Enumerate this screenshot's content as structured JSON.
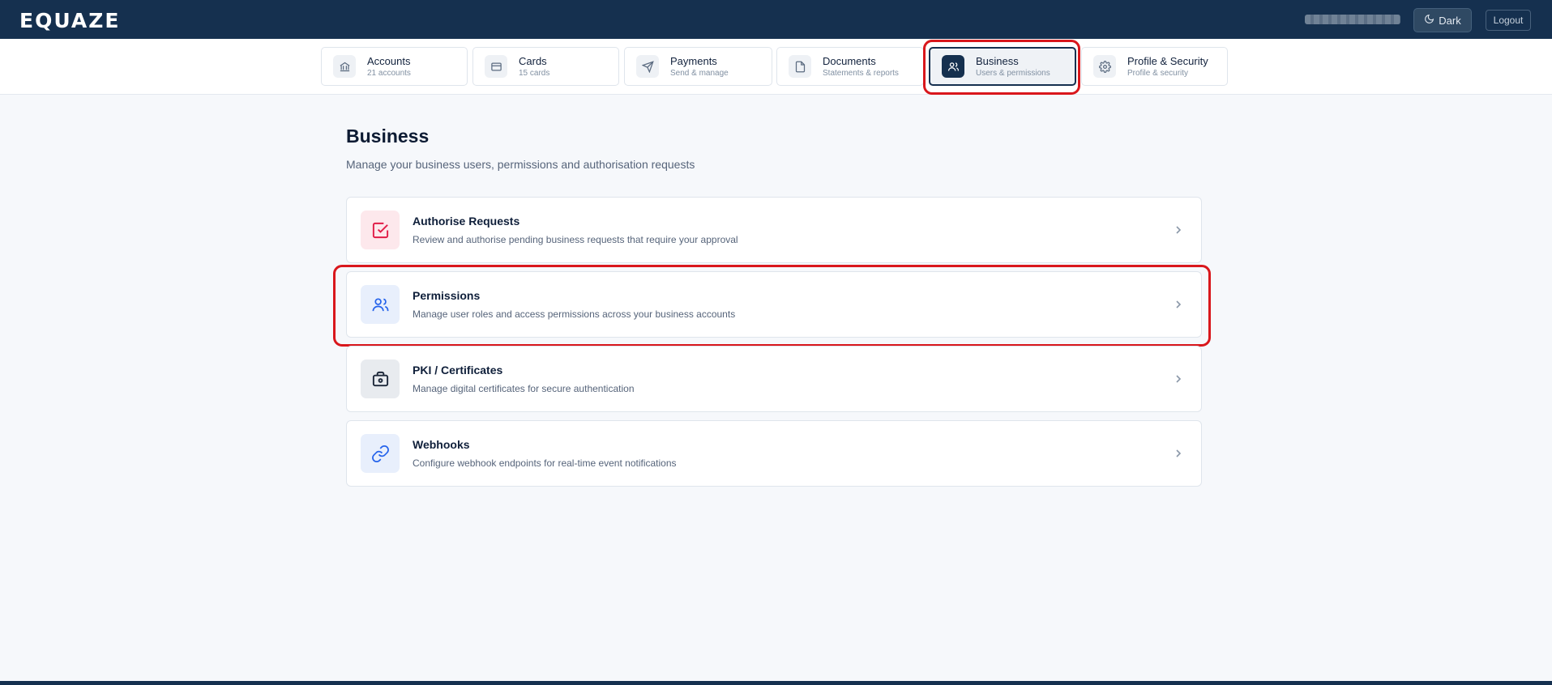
{
  "header": {
    "logo": "EQUAZE",
    "user_name": "",
    "theme_toggle_label": "Dark",
    "logout_label": "Logout"
  },
  "tabs": [
    {
      "label": "Accounts",
      "sub": "21 accounts",
      "icon": "bank-icon",
      "active": false
    },
    {
      "label": "Cards",
      "sub": "15 cards",
      "icon": "credit-card-icon",
      "active": false
    },
    {
      "label": "Payments",
      "sub": "Send & manage",
      "icon": "send-icon",
      "active": false
    },
    {
      "label": "Documents",
      "sub": "Statements & reports",
      "icon": "document-icon",
      "active": false
    },
    {
      "label": "Business",
      "sub": "Users & permissions",
      "icon": "users-icon",
      "active": true
    },
    {
      "label": "Profile & Security",
      "sub": "Profile & security",
      "icon": "gear-icon",
      "active": false
    }
  ],
  "page": {
    "title": "Business",
    "subtitle": "Manage your business users, permissions and authorisation requests"
  },
  "cards": [
    {
      "title": "Authorise Requests",
      "description": "Review and authorise pending business requests that require your approval",
      "icon": "check-square-icon",
      "icon_color": "#e11d48",
      "icon_bg": "#fde8ec"
    },
    {
      "title": "Permissions",
      "description": "Manage user roles and access permissions across your business accounts",
      "icon": "users-icon",
      "icon_color": "#2563eb",
      "icon_bg": "#e8effc"
    },
    {
      "title": "PKI / Certificates",
      "description": "Manage digital certificates for secure authentication",
      "icon": "certificate-icon",
      "icon_color": "#1e293b",
      "icon_bg": "#e8ebef"
    },
    {
      "title": "Webhooks",
      "description": "Configure webhook endpoints for real-time event notifications",
      "icon": "link-icon",
      "icon_color": "#2563eb",
      "icon_bg": "#e8effc"
    }
  ],
  "colors": {
    "navy": "#15304f",
    "highlight": "#d9171c",
    "background": "#f6f8fb"
  }
}
